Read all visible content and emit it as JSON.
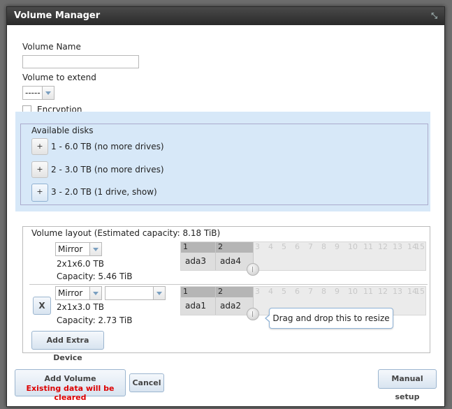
{
  "dialog": {
    "title": "Volume Manager",
    "close_glyph": "⤡"
  },
  "form": {
    "volume_name_label": "Volume Name",
    "volume_name_value": "",
    "volume_to_extend_label": "Volume to extend",
    "volume_to_extend_value": "-----",
    "encryption_label": "Encryption",
    "encryption_checked": false
  },
  "available_disks": {
    "legend": "Available disks",
    "add_glyph": "+",
    "items": [
      {
        "label": "1 - 6.0 TB (no more drives)"
      },
      {
        "label": "2 - 3.0 TB (no more drives)"
      },
      {
        "label": "3 - 2.0 TB (1 drive, show)"
      }
    ]
  },
  "layout": {
    "legend": "Volume layout (Estimated capacity: 8.18 TiB)",
    "column_numbers": [
      "1",
      "2",
      "3",
      "4",
      "5",
      "6",
      "7",
      "8",
      "9",
      "10",
      "11",
      "12",
      "13",
      "14",
      "15"
    ],
    "groups": [
      {
        "type": "Mirror",
        "size": "2x1x6.0 TB",
        "capacity": "Capacity: 5.46 TiB",
        "devices": [
          "ada3",
          "ada4"
        ]
      },
      {
        "type": "Mirror",
        "second_select": "",
        "size": "2x1x3.0 TB",
        "capacity": "Capacity: 2.73 TiB",
        "devices": [
          "ada1",
          "ada2"
        ],
        "remove_label": "X"
      }
    ],
    "tooltip": "Drag and drop this to resize",
    "add_extra_device": "Add Extra Device"
  },
  "footer": {
    "add_volume": "Add Volume",
    "add_volume_warning": "Existing data will be cleared",
    "cancel": "Cancel",
    "manual_setup": "Manual setup"
  },
  "colors": {
    "panel_blue": "#d7e8f8",
    "warning_red": "#dd0000",
    "titlebar": "#333333"
  }
}
